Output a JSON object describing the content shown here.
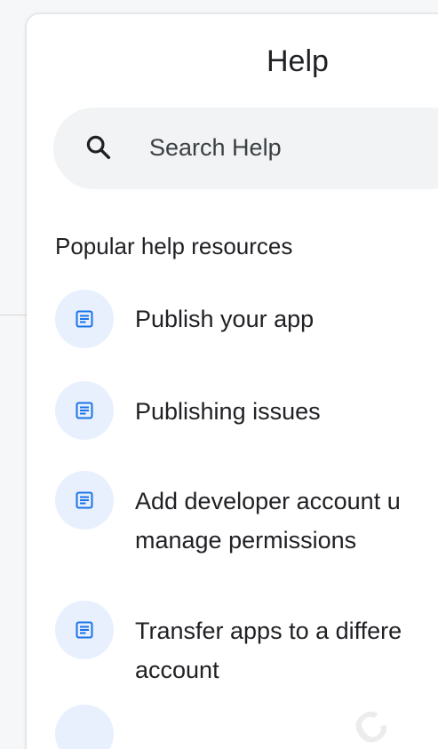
{
  "panel": {
    "title": "Help"
  },
  "search": {
    "placeholder": "Search Help",
    "value": ""
  },
  "popular": {
    "heading": "Popular help resources",
    "items": [
      {
        "line1": "Publish your app",
        "line2": "",
        "icon": "article-icon"
      },
      {
        "line1": "Publishing issues",
        "line2": "",
        "icon": "article-icon"
      },
      {
        "line1": "Add developer account u",
        "line2": "manage permissions",
        "icon": "article-icon"
      },
      {
        "line1": "Transfer apps to a differe",
        "line2": "account",
        "icon": "article-icon"
      }
    ]
  },
  "colors": {
    "badge_bg": "#e8f0fe",
    "icon_blue": "#1a73e8",
    "search_bg": "#f1f3f4",
    "text": "#202124"
  }
}
